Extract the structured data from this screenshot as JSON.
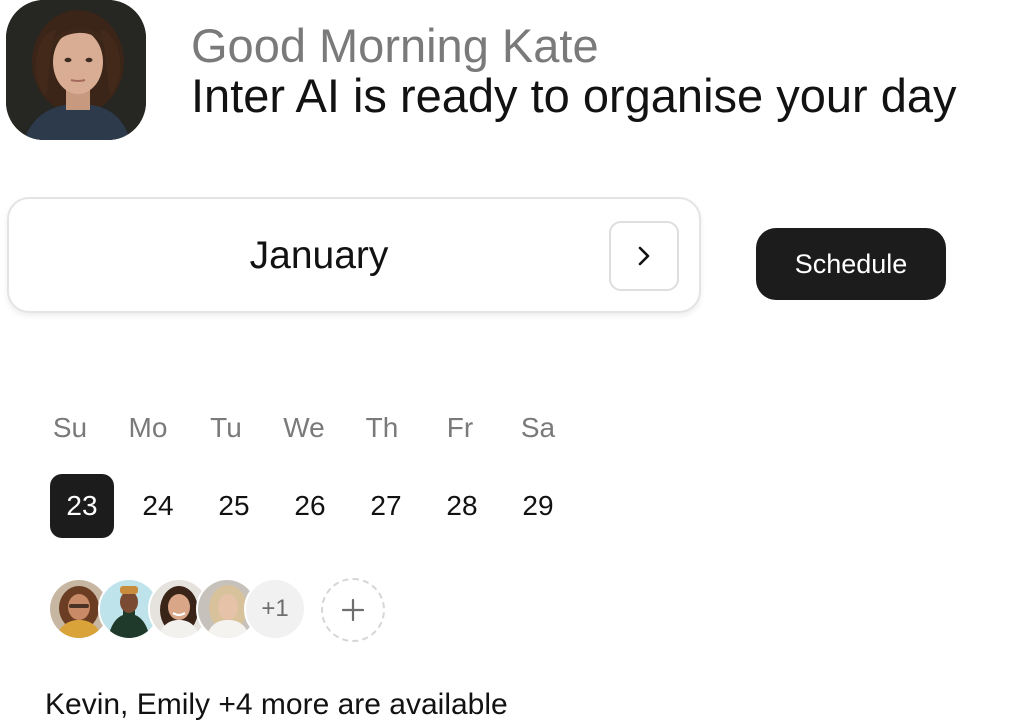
{
  "header": {
    "greeting": "Good Morning Kate",
    "headline": "Inter AI is ready to organise your day",
    "avatar_icon": "profile-photo"
  },
  "month_picker": {
    "month": "January",
    "next_icon": "chevron-right-icon"
  },
  "schedule_button": {
    "label": "Schedule"
  },
  "calendar": {
    "weekdays": [
      "Su",
      "Mo",
      "Tu",
      "We",
      "Th",
      "Fr",
      "Sa"
    ],
    "days": [
      "23",
      "24",
      "25",
      "26",
      "27",
      "28",
      "29"
    ],
    "selected_day": "23"
  },
  "attendees": {
    "more": "+1",
    "add_icon": "plus-icon",
    "availability": "Kevin, Emily +4 more are available"
  },
  "colors": {
    "primary_dark": "#1c1c1c",
    "muted_text": "#7a7a7a",
    "card_border": "#e4e4e4"
  }
}
